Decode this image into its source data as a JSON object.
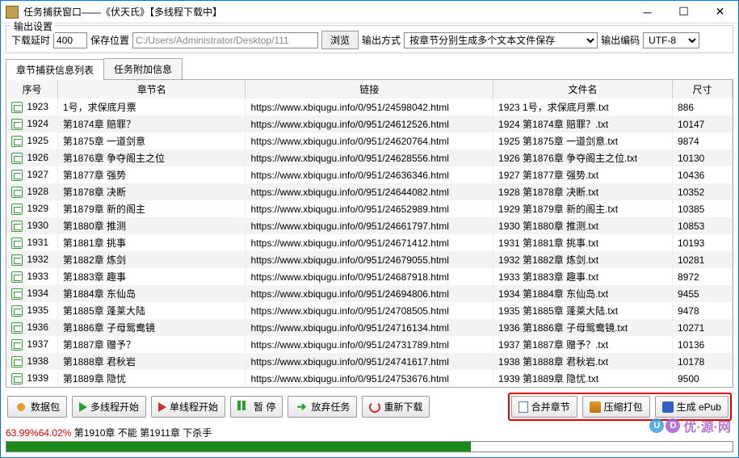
{
  "titlebar": {
    "text": "任务捕获窗口——《伏天氏》【多线程下载中】"
  },
  "settings": {
    "group_label": "输出设置",
    "delay_label": "下载延时",
    "delay_value": "400",
    "save_label": "保存位置",
    "save_value": "C:/Users/Administrator/Desktop/111",
    "browse": "浏览",
    "output_mode_label": "输出方式",
    "output_mode_value": "按章节分别生成多个文本文件保存",
    "encoding_label": "输出编码",
    "encoding_value": "UTF-8"
  },
  "tabs": {
    "t1": "章节捕获信息列表",
    "t2": "任务附加信息"
  },
  "columns": {
    "num": "序号",
    "name": "章节名",
    "link": "链接",
    "file": "文件名",
    "size": "尺寸"
  },
  "rows": [
    {
      "num": "1923",
      "name": "1号，求保底月票",
      "link": "https://www.xbiqugu.info/0/951/24598042.html",
      "file": "1923 1号，求保底月票.txt",
      "size": "886"
    },
    {
      "num": "1924",
      "name": "第1874章 赔罪？",
      "link": "https://www.xbiqugu.info/0/951/24612526.html",
      "file": "1924 第1874章 赔罪？.txt",
      "size": "10147"
    },
    {
      "num": "1925",
      "name": "第1875章 一道剑意",
      "link": "https://www.xbiqugu.info/0/951/24620764.html",
      "file": "1925 第1875章 一道剑意.txt",
      "size": "9874"
    },
    {
      "num": "1926",
      "name": "第1876章 争夺阁主之位",
      "link": "https://www.xbiqugu.info/0/951/24628556.html",
      "file": "1926 第1876章 争夺阁主之位.txt",
      "size": "10130"
    },
    {
      "num": "1927",
      "name": "第1877章 强势",
      "link": "https://www.xbiqugu.info/0/951/24636346.html",
      "file": "1927 第1877章 强势.txt",
      "size": "10436"
    },
    {
      "num": "1928",
      "name": "第1878章 决断",
      "link": "https://www.xbiqugu.info/0/951/24644082.html",
      "file": "1928 第1878章 决断.txt",
      "size": "10352"
    },
    {
      "num": "1929",
      "name": "第1879章 新的阁主",
      "link": "https://www.xbiqugu.info/0/951/24652989.html",
      "file": "1929 第1879章 新的阁主.txt",
      "size": "10385"
    },
    {
      "num": "1930",
      "name": "第1880章 推测",
      "link": "https://www.xbiqugu.info/0/951/24661797.html",
      "file": "1930 第1880章 推测.txt",
      "size": "10853"
    },
    {
      "num": "1931",
      "name": "第1881章 挑事",
      "link": "https://www.xbiqugu.info/0/951/24671412.html",
      "file": "1931 第1881章 挑事.txt",
      "size": "10193"
    },
    {
      "num": "1932",
      "name": "第1882章 炼剑",
      "link": "https://www.xbiqugu.info/0/951/24679055.html",
      "file": "1932 第1882章 炼剑.txt",
      "size": "10281"
    },
    {
      "num": "1933",
      "name": "第1883章 趣事",
      "link": "https://www.xbiqugu.info/0/951/24687918.html",
      "file": "1933 第1883章 趣事.txt",
      "size": "8972"
    },
    {
      "num": "1934",
      "name": "第1884章 东仙岛",
      "link": "https://www.xbiqugu.info/0/951/24694806.html",
      "file": "1934 第1884章 东仙岛.txt",
      "size": "9455"
    },
    {
      "num": "1935",
      "name": "第1885章 蓬莱大陆",
      "link": "https://www.xbiqugu.info/0/951/24708505.html",
      "file": "1935 第1885章 蓬莱大陆.txt",
      "size": "9478"
    },
    {
      "num": "1936",
      "name": "第1886章 子母鸳鸯镜",
      "link": "https://www.xbiqugu.info/0/951/24716134.html",
      "file": "1936 第1886章 子母鸳鸯镜.txt",
      "size": "10271"
    },
    {
      "num": "1937",
      "name": "第1887章 赠予？",
      "link": "https://www.xbiqugu.info/0/951/24731789.html",
      "file": "1937 第1887章 赠予？.txt",
      "size": "10136"
    },
    {
      "num": "1938",
      "name": "第1888章 君秋岩",
      "link": "https://www.xbiqugu.info/0/951/24741617.html",
      "file": "1938 第1888章 君秋岩.txt",
      "size": "10178"
    },
    {
      "num": "1939",
      "name": "第1889章 隐忧",
      "link": "https://www.xbiqugu.info/0/951/24753676.html",
      "file": "1939 第1889章 隐忧.txt",
      "size": "9500"
    }
  ],
  "toolbar": {
    "data_pkg": "数据包",
    "multi_start": "多线程开始",
    "single_start": "单线程开始",
    "pause": "暂 停",
    "abandon": "放弃任务",
    "redownload": "重新下载",
    "merge": "合并章节",
    "compress": "压缩打包",
    "epub": "生成 ePub"
  },
  "status": {
    "pct1": "63.99%",
    "pct2": "64.02%",
    "text": " 第1910章 不能 第1911章 下杀手",
    "progress_pct": 64
  },
  "watermark": {
    "text": "优·源·网"
  }
}
